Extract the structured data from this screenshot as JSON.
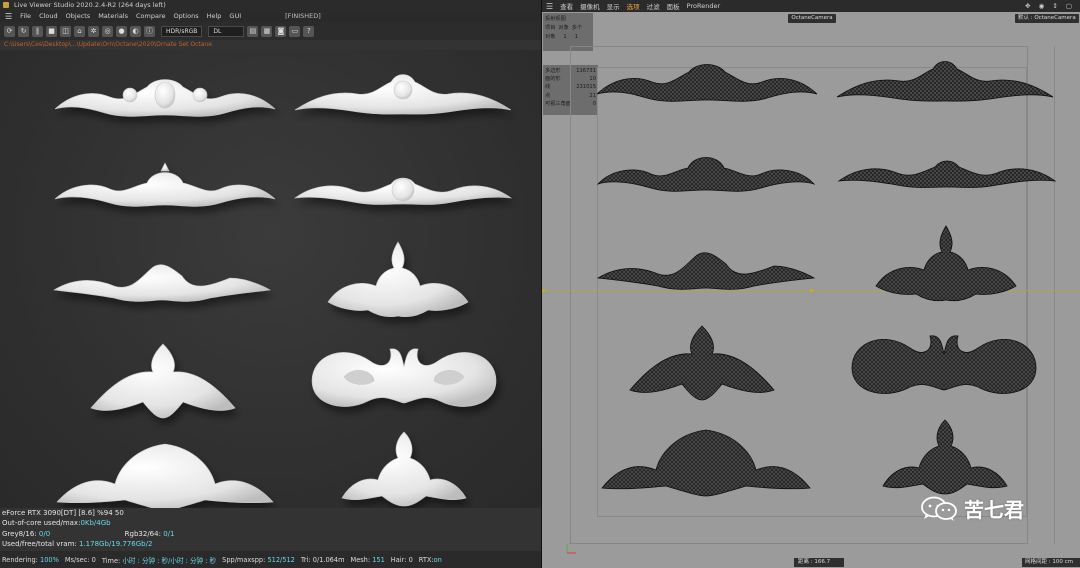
{
  "live_viewer": {
    "title": "Live Viewer Studio 2020.2.4-R2 (264 days left)",
    "menu": [
      "File",
      "Cloud",
      "Objects",
      "Materials",
      "Compare",
      "Options",
      "Help",
      "GUI"
    ],
    "status": "[FINISHED]",
    "toolbar": {
      "color_space": "HDR/sRGB",
      "kernel": "DL"
    },
    "path": "C:\\Users\\Ces\\Desktop\\...\\Update\\Orn\\Octane\\2020\\Ornate Set Octane",
    "stats": {
      "gpu_label": "eForce RTX 3090[DT]",
      "gpu_info": "[8.6]   %94    50",
      "out_of_core_label": "Out-of-core used/max:",
      "out_of_core_value": "0Kb/4Gb",
      "grey_label": "Grey8/16:",
      "grey_value": "0/0",
      "rgb_label": "Rgb32/64:",
      "rgb_value": "0/1",
      "vram_label": "Used/free/total vram:",
      "vram_value": "1.178Gb/19.776Gb/2"
    },
    "render_bar": {
      "rendering_label": "Rendering:",
      "rendering_value": "100%",
      "mssec_label": "Ms/sec:",
      "mssec_value": "0",
      "time_label": "Time:",
      "time_value": "小时 : 分钟 : 秒/小时 : 分钟 : 秒",
      "spp_label": "Spp/maxspp:",
      "spp_value": "512/512",
      "tri_label": "Tri:",
      "tri_value": "0/1.064m",
      "mesh_label": "Mesh:",
      "mesh_value": "151",
      "hair_label": "Hair:",
      "hair_value": "0",
      "rtx_label": "RTX:",
      "rtx_value": "on"
    }
  },
  "c4d_viewport": {
    "menu": [
      "查看",
      "摄像机",
      "显示",
      "选项",
      "过滤",
      "面板",
      "ProRender"
    ],
    "active_menu": "选项",
    "camera_label": "OctaneCamera",
    "camera_label_right": "默认 : OctaneCamera",
    "hud_top": {
      "title": "投射视图",
      "col1": "项目",
      "col2": "对象",
      "col3": "多个",
      "row_label": "对象",
      "row_value": "1",
      "row_value2": "1"
    },
    "hud_stats": [
      {
        "label": "多边形",
        "value": "116731"
      },
      {
        "label": "面的形",
        "value": "10"
      },
      {
        "label": "线",
        "value": "231015"
      },
      {
        "label": "点",
        "value": "21"
      },
      {
        "label": "可视三角面",
        "value": "0"
      }
    ],
    "bottom_ruler": "距离 : 166.7",
    "grid_label": "网格间距 : 100 cm"
  },
  "watermark": "苦七君"
}
